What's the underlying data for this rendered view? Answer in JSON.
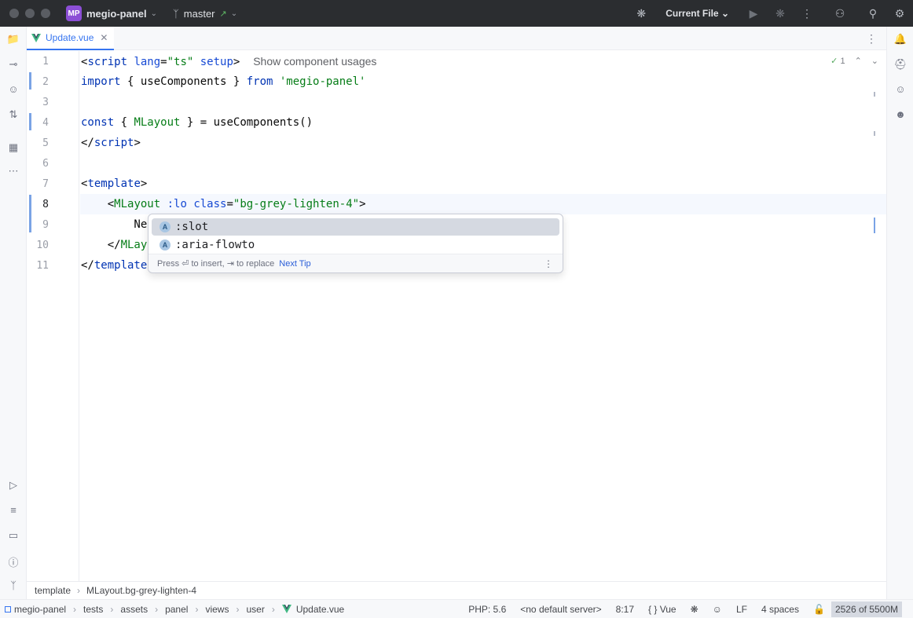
{
  "titlebar": {
    "project_badge": "MP",
    "project_name": "megio-panel",
    "branch": "master",
    "run_config": "Current File"
  },
  "tab": {
    "label": "Update.vue"
  },
  "editor": {
    "line_numbers": [
      "1",
      "2",
      "3",
      "4",
      "5",
      "6",
      "7",
      "8",
      "9",
      "10",
      "11"
    ],
    "hint": "Show component usages",
    "inspection_count": "1",
    "lines": {
      "l1_tag_open": "<",
      "l1_script": "script",
      "l1_lang": " lang",
      "l1_eq": "=",
      "l1_lang_val": "\"ts\"",
      "l1_setup": " setup",
      "l1_close": ">",
      "l2_import": "import",
      "l2_mid": " { useComponents } ",
      "l2_from": "from",
      "l2_str": " 'megio-panel'",
      "l4_const": "const",
      "l4_mid1": " { ",
      "l4_var": "MLayout",
      "l4_mid2": " } = useComponents()",
      "l5_close": "</",
      "l5_script": "script",
      "l5_gt": ">",
      "l7_open": "<",
      "l7_template": "template",
      "l7_gt": ">",
      "l8_indent": "    <",
      "l8_comp": "MLayout",
      "l8_lo": " :lo",
      "l8_class": " class",
      "l8_eq": "=",
      "l8_val": "\"bg-grey-lighten-4\"",
      "l8_gt": ">",
      "l9_text": "        Ne",
      "l10_open": "    </",
      "l10_comp": "MLay",
      "l11_open": "</",
      "l11_tag": "template"
    }
  },
  "completion": {
    "items": [
      {
        "icon": "A",
        "label": ":slot"
      },
      {
        "icon": "A",
        "label": ":aria-flowto"
      }
    ],
    "footer_text": "Press ⏎ to insert, ⇥ to replace",
    "next_tip": "Next Tip"
  },
  "breadcrumb": [
    "template",
    "MLayout.bg-grey-lighten-4"
  ],
  "statusbar": {
    "path": [
      "megio-panel",
      "tests",
      "assets",
      "panel",
      "views",
      "user",
      "Update.vue"
    ],
    "php": "PHP: 5.6",
    "server": "<no default server>",
    "position": "8:17",
    "language": "{ } Vue",
    "line_ending": "LF",
    "indent": "4 spaces",
    "memory": "2526 of 5500M"
  },
  "icons": {
    "titlebar": [
      "window-close-icon",
      "window-minimize-icon",
      "window-zoom-icon",
      "chevron-down-icon",
      "git-branch-icon",
      "debug-icon",
      "run-icon",
      "stop-debug-icon",
      "more-vertical-icon",
      "add-user-icon",
      "search-icon",
      "settings-icon"
    ],
    "left_strip": [
      "project-icon",
      "commit-icon",
      "copilot-icon",
      "pull-request-icon",
      "structure-icon",
      "more-icon",
      "services-icon",
      "todo-icon",
      "terminal-icon",
      "problems-icon",
      "git-icon"
    ],
    "right_strip": [
      "notifications-icon",
      "database-icon",
      "copilot-chat-icon",
      "ai-assistant-icon"
    ]
  },
  "colors": {
    "accent": "#3574f0",
    "keyword": "#0033b3",
    "string": "#067d17",
    "project_badge": "#8c4fd6"
  }
}
